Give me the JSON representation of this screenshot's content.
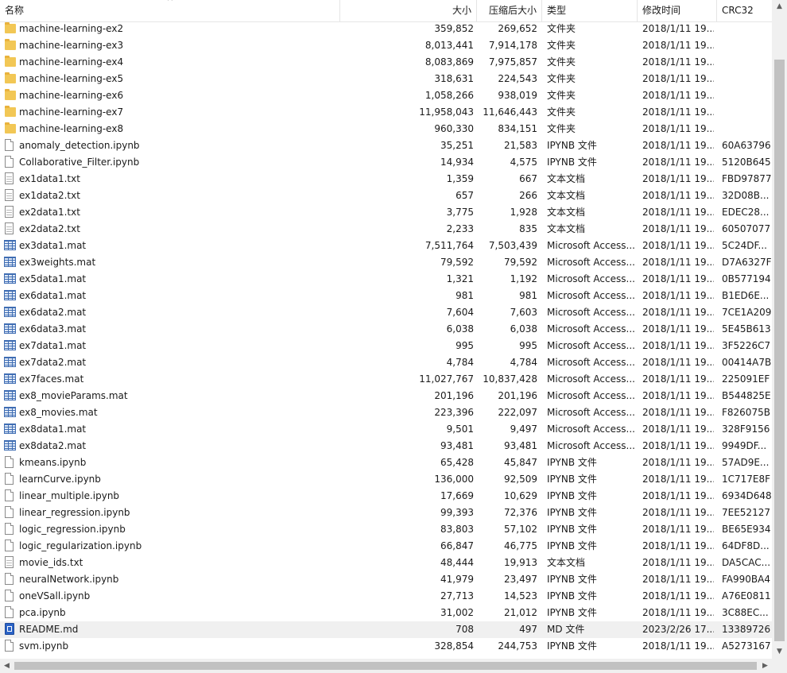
{
  "columns": {
    "name": "名称",
    "size": "大小",
    "packed": "压缩后大小",
    "type": "类型",
    "modified": "修改时间",
    "crc": "CRC32"
  },
  "sort_indicator": "^",
  "scroll_arrows": {
    "up": "▲",
    "down": "▼",
    "left": "◀",
    "right": "▶"
  },
  "rows": [
    {
      "icon": "folder-icon",
      "name": "machine-learning-ex2",
      "size": "359,852",
      "packed": "269,652",
      "type": "文件夹",
      "modified": "2018/1/11 19...",
      "crc": ""
    },
    {
      "icon": "folder-icon",
      "name": "machine-learning-ex3",
      "size": "8,013,441",
      "packed": "7,914,178",
      "type": "文件夹",
      "modified": "2018/1/11 19...",
      "crc": ""
    },
    {
      "icon": "folder-icon",
      "name": "machine-learning-ex4",
      "size": "8,083,869",
      "packed": "7,975,857",
      "type": "文件夹",
      "modified": "2018/1/11 19...",
      "crc": ""
    },
    {
      "icon": "folder-icon",
      "name": "machine-learning-ex5",
      "size": "318,631",
      "packed": "224,543",
      "type": "文件夹",
      "modified": "2018/1/11 19...",
      "crc": ""
    },
    {
      "icon": "folder-icon",
      "name": "machine-learning-ex6",
      "size": "1,058,266",
      "packed": "938,019",
      "type": "文件夹",
      "modified": "2018/1/11 19...",
      "crc": ""
    },
    {
      "icon": "folder-icon",
      "name": "machine-learning-ex7",
      "size": "11,958,043",
      "packed": "11,646,443",
      "type": "文件夹",
      "modified": "2018/1/11 19...",
      "crc": ""
    },
    {
      "icon": "folder-icon",
      "name": "machine-learning-ex8",
      "size": "960,330",
      "packed": "834,151",
      "type": "文件夹",
      "modified": "2018/1/11 19...",
      "crc": ""
    },
    {
      "icon": "file-icon",
      "name": "anomaly_detection.ipynb",
      "size": "35,251",
      "packed": "21,583",
      "type": "IPYNB 文件",
      "modified": "2018/1/11 19...",
      "crc": "60A63796"
    },
    {
      "icon": "file-icon",
      "name": "Collaborative_Filter.ipynb",
      "size": "14,934",
      "packed": "4,575",
      "type": "IPYNB 文件",
      "modified": "2018/1/11 19...",
      "crc": "5120B645"
    },
    {
      "icon": "text-file-icon",
      "name": "ex1data1.txt",
      "size": "1,359",
      "packed": "667",
      "type": "文本文档",
      "modified": "2018/1/11 19...",
      "crc": "FBD97877"
    },
    {
      "icon": "text-file-icon",
      "name": "ex1data2.txt",
      "size": "657",
      "packed": "266",
      "type": "文本文档",
      "modified": "2018/1/11 19...",
      "crc": "32D08B..."
    },
    {
      "icon": "text-file-icon",
      "name": "ex2data1.txt",
      "size": "3,775",
      "packed": "1,928",
      "type": "文本文档",
      "modified": "2018/1/11 19...",
      "crc": "EDEC28..."
    },
    {
      "icon": "text-file-icon",
      "name": "ex2data2.txt",
      "size": "2,233",
      "packed": "835",
      "type": "文本文档",
      "modified": "2018/1/11 19...",
      "crc": "60507077"
    },
    {
      "icon": "access-table-icon",
      "name": "ex3data1.mat",
      "size": "7,511,764",
      "packed": "7,503,439",
      "type": "Microsoft Access...",
      "modified": "2018/1/11 19...",
      "crc": "5C24DF..."
    },
    {
      "icon": "access-table-icon",
      "name": "ex3weights.mat",
      "size": "79,592",
      "packed": "79,592",
      "type": "Microsoft Access...",
      "modified": "2018/1/11 19...",
      "crc": "D7A6327F"
    },
    {
      "icon": "access-table-icon",
      "name": "ex5data1.mat",
      "size": "1,321",
      "packed": "1,192",
      "type": "Microsoft Access...",
      "modified": "2018/1/11 19...",
      "crc": "0B577194"
    },
    {
      "icon": "access-table-icon",
      "name": "ex6data1.mat",
      "size": "981",
      "packed": "981",
      "type": "Microsoft Access...",
      "modified": "2018/1/11 19...",
      "crc": "B1ED6E..."
    },
    {
      "icon": "access-table-icon",
      "name": "ex6data2.mat",
      "size": "7,604",
      "packed": "7,603",
      "type": "Microsoft Access...",
      "modified": "2018/1/11 19...",
      "crc": "7CE1A209"
    },
    {
      "icon": "access-table-icon",
      "name": "ex6data3.mat",
      "size": "6,038",
      "packed": "6,038",
      "type": "Microsoft Access...",
      "modified": "2018/1/11 19...",
      "crc": "5E45B613"
    },
    {
      "icon": "access-table-icon",
      "name": "ex7data1.mat",
      "size": "995",
      "packed": "995",
      "type": "Microsoft Access...",
      "modified": "2018/1/11 19...",
      "crc": "3F5226C7"
    },
    {
      "icon": "access-table-icon",
      "name": "ex7data2.mat",
      "size": "4,784",
      "packed": "4,784",
      "type": "Microsoft Access...",
      "modified": "2018/1/11 19...",
      "crc": "00414A7B"
    },
    {
      "icon": "access-table-icon",
      "name": "ex7faces.mat",
      "size": "11,027,767",
      "packed": "10,837,428",
      "type": "Microsoft Access...",
      "modified": "2018/1/11 19...",
      "crc": "225091EF"
    },
    {
      "icon": "access-table-icon",
      "name": "ex8_movieParams.mat",
      "size": "201,196",
      "packed": "201,196",
      "type": "Microsoft Access...",
      "modified": "2018/1/11 19...",
      "crc": "B544825E"
    },
    {
      "icon": "access-table-icon",
      "name": "ex8_movies.mat",
      "size": "223,396",
      "packed": "222,097",
      "type": "Microsoft Access...",
      "modified": "2018/1/11 19...",
      "crc": "F826075B"
    },
    {
      "icon": "access-table-icon",
      "name": "ex8data1.mat",
      "size": "9,501",
      "packed": "9,497",
      "type": "Microsoft Access...",
      "modified": "2018/1/11 19...",
      "crc": "328F9156"
    },
    {
      "icon": "access-table-icon",
      "name": "ex8data2.mat",
      "size": "93,481",
      "packed": "93,481",
      "type": "Microsoft Access...",
      "modified": "2018/1/11 19...",
      "crc": "9949DF..."
    },
    {
      "icon": "file-icon",
      "name": "kmeans.ipynb",
      "size": "65,428",
      "packed": "45,847",
      "type": "IPYNB 文件",
      "modified": "2018/1/11 19...",
      "crc": "57AD9E..."
    },
    {
      "icon": "file-icon",
      "name": "learnCurve.ipynb",
      "size": "136,000",
      "packed": "92,509",
      "type": "IPYNB 文件",
      "modified": "2018/1/11 19...",
      "crc": "1C717E8F"
    },
    {
      "icon": "file-icon",
      "name": "linear_multiple.ipynb",
      "size": "17,669",
      "packed": "10,629",
      "type": "IPYNB 文件",
      "modified": "2018/1/11 19...",
      "crc": "6934D648"
    },
    {
      "icon": "file-icon",
      "name": "linear_regression.ipynb",
      "size": "99,393",
      "packed": "72,376",
      "type": "IPYNB 文件",
      "modified": "2018/1/11 19...",
      "crc": "7EE52127"
    },
    {
      "icon": "file-icon",
      "name": "logic_regression.ipynb",
      "size": "83,803",
      "packed": "57,102",
      "type": "IPYNB 文件",
      "modified": "2018/1/11 19...",
      "crc": "BE65E934"
    },
    {
      "icon": "file-icon",
      "name": "logic_regularization.ipynb",
      "size": "66,847",
      "packed": "46,775",
      "type": "IPYNB 文件",
      "modified": "2018/1/11 19...",
      "crc": "64DF8D..."
    },
    {
      "icon": "text-file-icon",
      "name": "movie_ids.txt",
      "size": "48,444",
      "packed": "19,913",
      "type": "文本文档",
      "modified": "2018/1/11 19...",
      "crc": "DA5CAC..."
    },
    {
      "icon": "file-icon",
      "name": "neuralNetwork.ipynb",
      "size": "41,979",
      "packed": "23,497",
      "type": "IPYNB 文件",
      "modified": "2018/1/11 19...",
      "crc": "FA990BA4"
    },
    {
      "icon": "file-icon",
      "name": "oneVSall.ipynb",
      "size": "27,713",
      "packed": "14,523",
      "type": "IPYNB 文件",
      "modified": "2018/1/11 19...",
      "crc": "A76E0811"
    },
    {
      "icon": "file-icon",
      "name": "pca.ipynb",
      "size": "31,002",
      "packed": "21,012",
      "type": "IPYNB 文件",
      "modified": "2018/1/11 19...",
      "crc": "3C88EC..."
    },
    {
      "icon": "markdown-file-icon",
      "name": "README.md",
      "size": "708",
      "packed": "497",
      "type": "MD 文件",
      "modified": "2023/2/26 17...",
      "crc": "13389726",
      "selected": true
    },
    {
      "icon": "file-icon",
      "name": "svm.ipynb",
      "size": "328,854",
      "packed": "244,753",
      "type": "IPYNB 文件",
      "modified": "2018/1/11 19...",
      "crc": "A5273167"
    }
  ]
}
